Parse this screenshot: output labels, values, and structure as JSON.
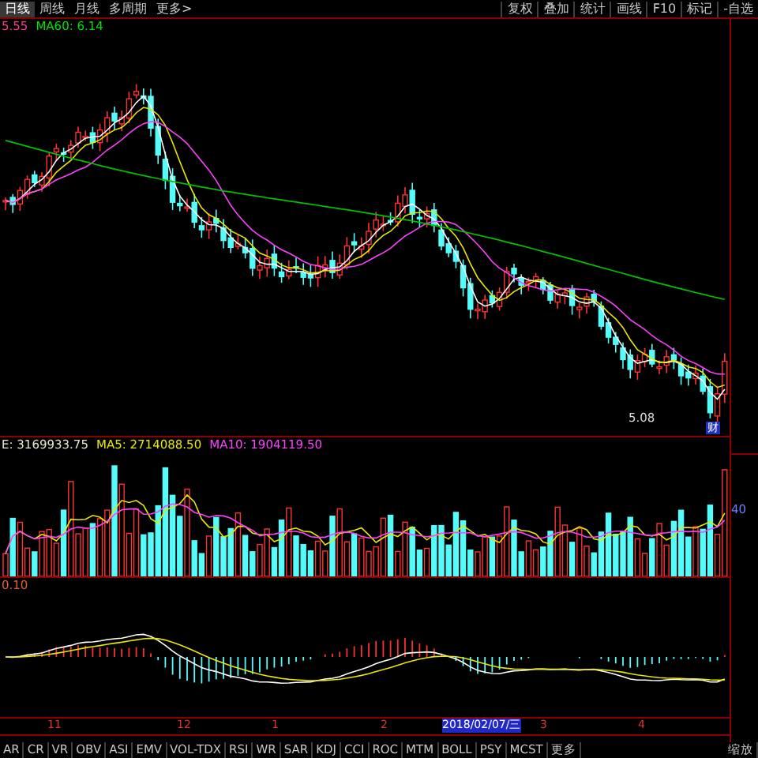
{
  "period_tabs": [
    {
      "label": "日线",
      "selected": true
    },
    {
      "label": "周线",
      "selected": false
    },
    {
      "label": "月线",
      "selected": false
    },
    {
      "label": "多周期",
      "selected": false
    },
    {
      "label": "更多>",
      "selected": false
    }
  ],
  "tools": [
    "复权",
    "叠加",
    "统计",
    "画线",
    "F10",
    "标记",
    "-自选"
  ],
  "price_legend": [
    {
      "text": "5.55",
      "color": "#ff3b8c"
    },
    {
      "text": "MA60: 6.14",
      "color": "#00e000"
    }
  ],
  "price_marks": {
    "low": "5.08",
    "badge": "财"
  },
  "volume_legend": [
    {
      "text": "E: 3169933.75",
      "color": "#e8e8c8"
    },
    {
      "text": "MA5: 2714088.50",
      "color": "#e8e800"
    },
    {
      "text": "MA10: 1904119.50",
      "color": "#ff40ff"
    }
  ],
  "volume_axis": "40",
  "macd_legend": "0.10",
  "date_axis": [
    {
      "label": "11",
      "selected": false
    },
    {
      "label": "12",
      "selected": false
    },
    {
      "label": "1",
      "selected": false
    },
    {
      "label": "2",
      "selected": false
    },
    {
      "label": "2018/02/07/三",
      "selected": true
    },
    {
      "label": "3",
      "selected": false
    },
    {
      "label": "4",
      "selected": false
    }
  ],
  "indicator_tabs": [
    "AR",
    "CR",
    "VR",
    "OBV",
    "ASI",
    "EMV",
    "VOL-TDX",
    "RSI",
    "WR",
    "SAR",
    "KDJ",
    "CCI",
    "ROC",
    "MTM",
    "BOLL",
    "PSY",
    "MCST",
    "更多"
  ],
  "zoom_button": "缩放"
}
